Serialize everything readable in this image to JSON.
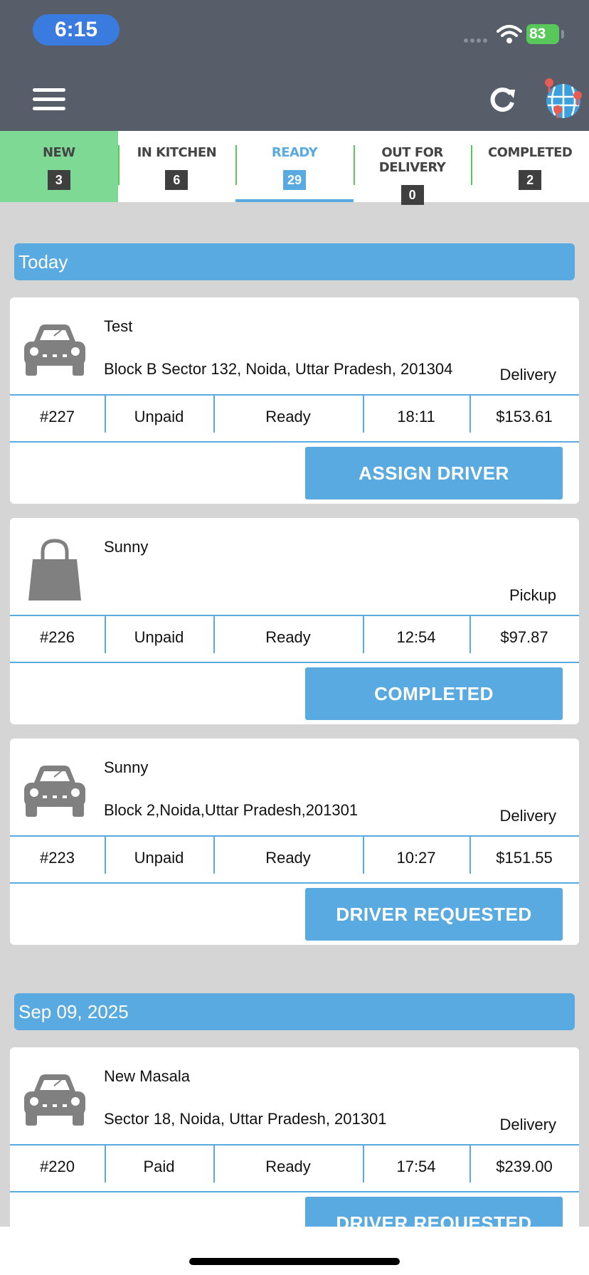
{
  "status_bar": {
    "time": "6:15",
    "battery": "83"
  },
  "tabs": [
    {
      "label": "NEW",
      "count": "3"
    },
    {
      "label": "IN KITCHEN",
      "count": "6"
    },
    {
      "label": "READY",
      "count": "29"
    },
    {
      "label": "OUT FOR DELIVERY",
      "count": "0"
    },
    {
      "label": "COMPLETED",
      "count": "2"
    }
  ],
  "sections": [
    {
      "date": "Today",
      "orders": [
        {
          "icon": "car-icon",
          "customer": "Test",
          "address": "Block B Sector 132, Noida, Uttar Pradesh, 201304",
          "type": "Delivery",
          "number": "#227",
          "payment": "Unpaid",
          "status": "Ready",
          "time": "18:11",
          "amount": "$153.61",
          "action": "ASSIGN DRIVER"
        },
        {
          "icon": "shopping-bag-icon",
          "customer": "Sunny",
          "address": "",
          "type": "Pickup",
          "number": "#226",
          "payment": "Unpaid",
          "status": "Ready",
          "time": "12:54",
          "amount": "$97.87",
          "action": "COMPLETED"
        },
        {
          "icon": "car-icon",
          "customer": "Sunny",
          "address": "Block 2,Noida,Uttar Pradesh,201301",
          "type": "Delivery",
          "number": "#223",
          "payment": "Unpaid",
          "status": "Ready",
          "time": "10:27",
          "amount": "$151.55",
          "action": "DRIVER REQUESTED"
        }
      ]
    },
    {
      "date": "Sep 09, 2025",
      "orders": [
        {
          "icon": "car-icon",
          "customer": "New Masala",
          "address": "Sector 18, Noida, Uttar Pradesh, 201301",
          "type": "Delivery",
          "number": "#220",
          "payment": "Paid",
          "status": "Ready",
          "time": "17:54",
          "amount": "$239.00",
          "action": "DRIVER REQUESTED"
        }
      ]
    }
  ],
  "colors": {
    "header": "#575d69",
    "accent": "#59aae0",
    "new_tab": "#7dd994",
    "divider": "#59c85a",
    "icon_gray": "#808080"
  }
}
